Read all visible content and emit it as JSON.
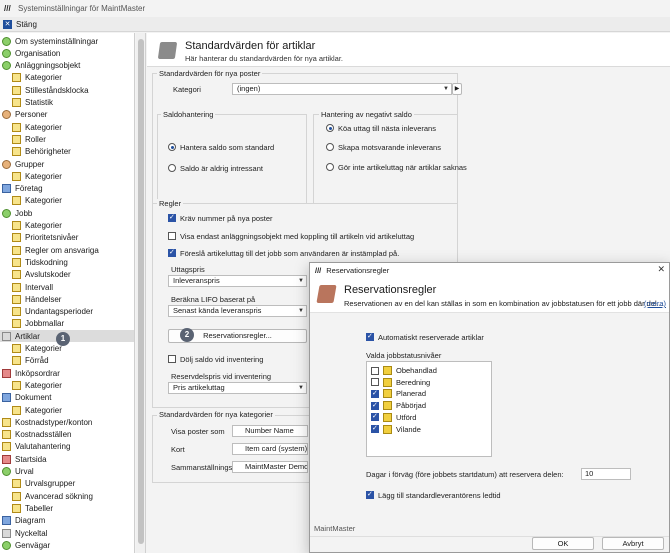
{
  "window": {
    "title": "Systeminställningar för MaintMaster",
    "close_label": "Stäng"
  },
  "tree": {
    "items": [
      {
        "label": "Om systeminställningar",
        "indent": 0,
        "icon": "green"
      },
      {
        "label": "Organisation",
        "indent": 0,
        "icon": "green"
      },
      {
        "label": "Anläggningsobjekt",
        "indent": 0,
        "icon": "green"
      },
      {
        "label": "Kategorier",
        "indent": 1,
        "icon": "folder"
      },
      {
        "label": "Stilleståndsklocka",
        "indent": 1,
        "icon": "folder"
      },
      {
        "label": "Statistik",
        "indent": 1,
        "icon": "folder"
      },
      {
        "label": "Personer",
        "indent": 0,
        "icon": "person"
      },
      {
        "label": "Kategorier",
        "indent": 1,
        "icon": "folder"
      },
      {
        "label": "Roller",
        "indent": 1,
        "icon": "folder"
      },
      {
        "label": "Behörigheter",
        "indent": 1,
        "icon": "folder"
      },
      {
        "label": "Grupper",
        "indent": 0,
        "icon": "person"
      },
      {
        "label": "Kategorier",
        "indent": 1,
        "icon": "folder"
      },
      {
        "label": "Företag",
        "indent": 0,
        "icon": "blue"
      },
      {
        "label": "Kategorier",
        "indent": 1,
        "icon": "folder"
      },
      {
        "label": "Jobb",
        "indent": 0,
        "icon": "green"
      },
      {
        "label": "Kategorier",
        "indent": 1,
        "icon": "folder"
      },
      {
        "label": "Prioritetsnivåer",
        "indent": 1,
        "icon": "folder"
      },
      {
        "label": "Regler om ansvariga",
        "indent": 1,
        "icon": "folder"
      },
      {
        "label": "Tidskodning",
        "indent": 1,
        "icon": "folder"
      },
      {
        "label": "Avslutskoder",
        "indent": 1,
        "icon": "folder"
      },
      {
        "label": "Intervall",
        "indent": 1,
        "icon": "folder"
      },
      {
        "label": "Händelser",
        "indent": 1,
        "icon": "folder"
      },
      {
        "label": "Undantagsperioder",
        "indent": 1,
        "icon": "folder"
      },
      {
        "label": "Jobbmallar",
        "indent": 1,
        "icon": "folder"
      },
      {
        "label": "Artiklar",
        "indent": 0,
        "icon": "gray",
        "selected": true
      },
      {
        "label": "Kategorier",
        "indent": 1,
        "icon": "folder"
      },
      {
        "label": "Förråd",
        "indent": 1,
        "icon": "folder"
      },
      {
        "label": "Inköpsordrar",
        "indent": 0,
        "icon": "red"
      },
      {
        "label": "Kategorier",
        "indent": 1,
        "icon": "folder"
      },
      {
        "label": "Dokument",
        "indent": 0,
        "icon": "blue"
      },
      {
        "label": "Kategorier",
        "indent": 1,
        "icon": "folder"
      },
      {
        "label": "Kostnadstyper/konton",
        "indent": 0,
        "icon": "folder"
      },
      {
        "label": "Kostnadsställen",
        "indent": 0,
        "icon": "folder"
      },
      {
        "label": "Valutahantering",
        "indent": 0,
        "icon": "folder"
      },
      {
        "label": "Startsida",
        "indent": 0,
        "icon": "red"
      },
      {
        "label": "Urval",
        "indent": 0,
        "icon": "green"
      },
      {
        "label": "Urvalsgrupper",
        "indent": 1,
        "icon": "folder"
      },
      {
        "label": "Avancerad sökning",
        "indent": 1,
        "icon": "folder"
      },
      {
        "label": "Tabeller",
        "indent": 1,
        "icon": "folder"
      },
      {
        "label": "Diagram",
        "indent": 0,
        "icon": "blue"
      },
      {
        "label": "Nyckeltal",
        "indent": 0,
        "icon": "gray"
      },
      {
        "label": "Genvägar",
        "indent": 0,
        "icon": "green"
      }
    ]
  },
  "main": {
    "title": "Standardvärden för artiklar",
    "subtitle": "Här hanterar du standardvärden för nya artiklar.",
    "new_posts_group": "Standardvärden för nya poster",
    "category_label": "Kategori",
    "category_value": "(ingen)",
    "balance_group": "Saldohantering",
    "balance_options": [
      "Hantera saldo som standard",
      "Saldo är aldrig intressant"
    ],
    "negative_group": "Hantering av negativt saldo",
    "negative_options": [
      "Köa uttag till nästa inleverans",
      "Skapa motsvarande inleverans",
      "Gör inte artikeluttag när artiklar saknas"
    ],
    "rules_group": "Regler",
    "rules": [
      {
        "label": "Kräv nummer på nya poster",
        "checked": true
      },
      {
        "label": "Visa endast anläggningsobjekt med koppling till artikeln vid artikeluttag",
        "checked": false
      },
      {
        "label": "Föreslå artikeluttag till det jobb som användaren är instämplad på.",
        "checked": true
      }
    ],
    "withdrawal_price_label": "Uttagspris",
    "withdrawal_price_value": "Inleveranspris",
    "lifo_label": "Beräkna LIFO baserat på",
    "lifo_value": "Senast kända leveranspris",
    "reservation_button": "Reservationsregler...",
    "hide_balance_label": "Dölj saldo vid inventering",
    "reserve_price_label": "Reservdelspris vid inventering",
    "reserve_price_value": "Pris artikeluttag",
    "categories_group": "Standardvärden för nya kategorier",
    "show_posts_label": "Visa poster som",
    "show_posts_value": "Number Name",
    "card_label": "Kort",
    "card_value": "Item card (system)",
    "summary_label": "Sammanställningssi",
    "summary_value": "MaintMaster Demo -"
  },
  "badges": [
    "1",
    "2"
  ],
  "dialog": {
    "window_title": "Reservationsregler",
    "title": "Reservationsregler",
    "subtitle": "Reservationen av en del kan ställas in som en kombination av jobbstatusen för ett jobb där del...",
    "more_link": "(mera)",
    "auto_reserve_label": "Automatiskt reserverade artiklar",
    "status_levels_label": "Valda jobbstatusnivåer",
    "statuses": [
      {
        "label": "Obehandlad",
        "checked": false
      },
      {
        "label": "Beredning",
        "checked": false
      },
      {
        "label": "Planerad",
        "checked": true
      },
      {
        "label": "Påbörjad",
        "checked": true
      },
      {
        "label": "Utförd",
        "checked": true
      },
      {
        "label": "Vilande",
        "checked": true
      }
    ],
    "days_label": "Dagar i förväg (före jobbets startdatum) att reservera delen:",
    "days_value": "10",
    "lead_time_label": "Lägg till standardleverantörens ledtid",
    "footer_label": "MaintMaster",
    "ok_label": "OK",
    "cancel_label": "Avbryt"
  }
}
